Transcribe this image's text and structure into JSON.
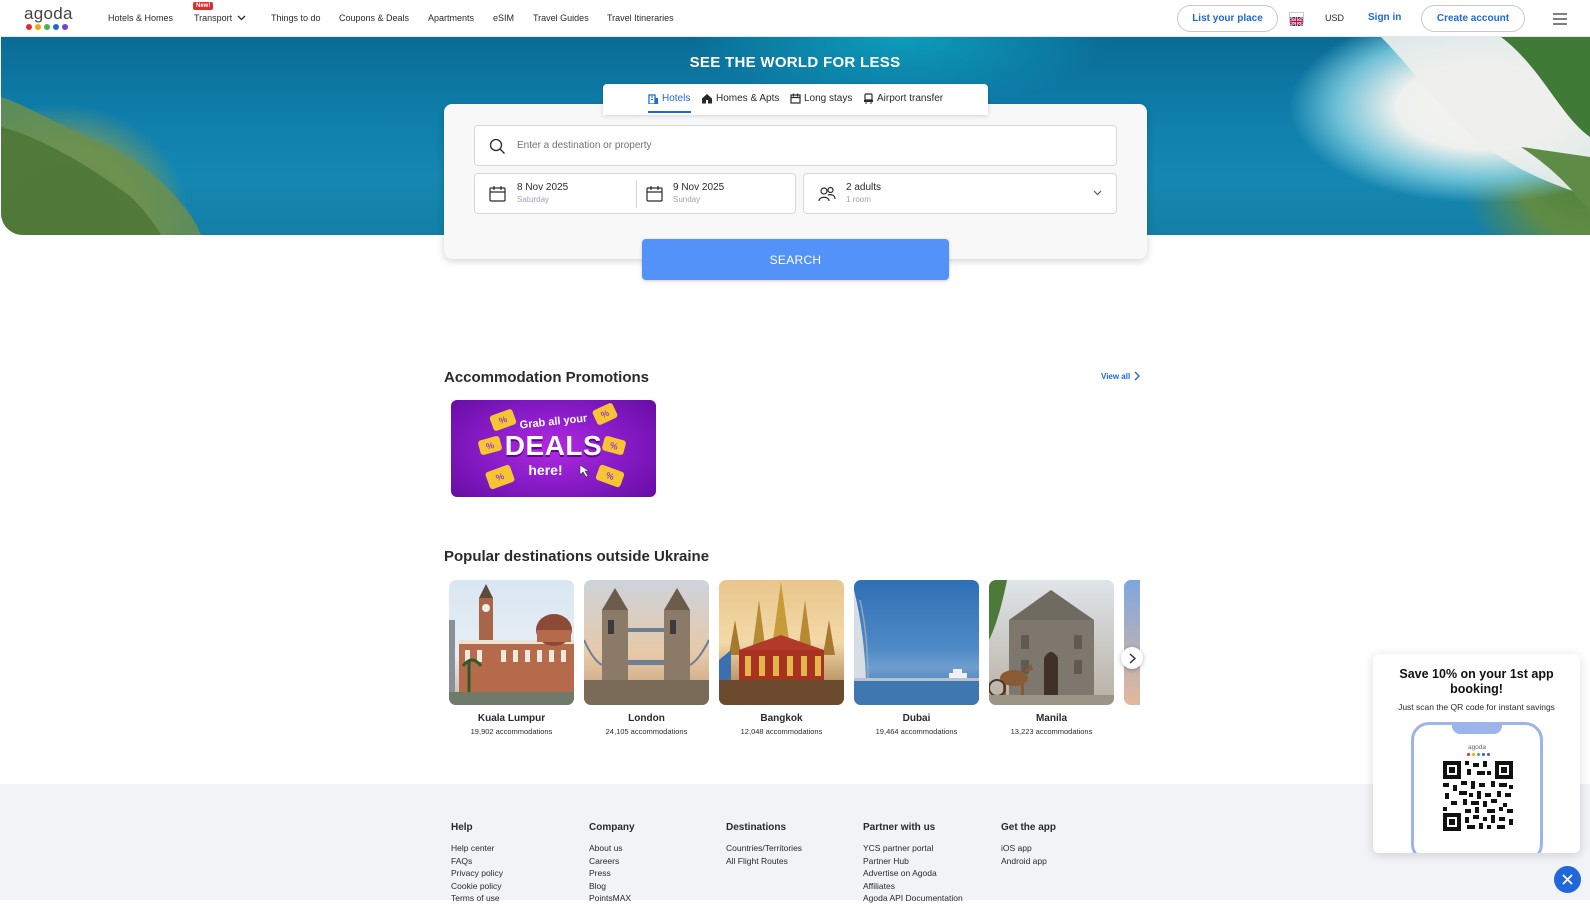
{
  "header": {
    "logo_text": "agoda",
    "logo_colors": [
      "#e12d2d",
      "#f7a70a",
      "#4caf50",
      "#2067da",
      "#7b3fc7"
    ],
    "nav": [
      "Hotels & Homes",
      "Transport",
      "Things to do",
      "Coupons & Deals",
      "Apartments",
      "eSIM",
      "Travel Guides",
      "Travel Itineraries"
    ],
    "new_badge": "New!",
    "list_place": "List your place",
    "currency": "USD",
    "sign_in": "Sign in",
    "create_account": "Create account"
  },
  "hero": {
    "title": "SEE THE WORLD FOR LESS",
    "tabs": [
      "Hotels",
      "Homes & Apts",
      "Long stays",
      "Airport transfer"
    ],
    "active_tab": "Hotels"
  },
  "search": {
    "destination_placeholder": "Enter a destination or property",
    "checkin_date": "8 Nov 2025",
    "checkin_day": "Saturday",
    "checkout_date": "9 Nov 2025",
    "checkout_day": "Sunday",
    "guests": "2 adults",
    "rooms": "1 room",
    "button": "SEARCH"
  },
  "promotions": {
    "title": "Accommodation Promotions",
    "view_all": "View all",
    "banner": {
      "line1": "Grab all your",
      "line2": "DEALS",
      "line3": "here!"
    }
  },
  "popular": {
    "title": "Popular destinations outside Ukraine",
    "destinations": [
      {
        "name": "Kuala Lumpur",
        "count": "19,902 accommodations"
      },
      {
        "name": "London",
        "count": "24,105 accommodations"
      },
      {
        "name": "Bangkok",
        "count": "12,048 accommodations"
      },
      {
        "name": "Dubai",
        "count": "19,464 accommodations"
      },
      {
        "name": "Manila",
        "count": "13,223 accommodations"
      }
    ]
  },
  "footer": {
    "columns": [
      {
        "title": "Help",
        "links": [
          "Help center",
          "FAQs",
          "Privacy policy",
          "Cookie policy",
          "Terms of use"
        ]
      },
      {
        "title": "Company",
        "links": [
          "About us",
          "Careers",
          "Press",
          "Blog",
          "PointsMAX"
        ]
      },
      {
        "title": "Destinations",
        "links": [
          "Countries/Territories",
          "All Flight Routes"
        ]
      },
      {
        "title": "Partner with us",
        "links": [
          "YCS partner portal",
          "Partner Hub",
          "Advertise on Agoda",
          "Affiliates",
          "Agoda API Documentation"
        ]
      },
      {
        "title": "Get the app",
        "links": [
          "iOS app",
          "Android app"
        ]
      }
    ]
  },
  "app_popup": {
    "title": "Save 10% on your 1st app booking!",
    "subtitle": "Just scan the QR code for instant savings",
    "phone_logo": "agoda"
  }
}
